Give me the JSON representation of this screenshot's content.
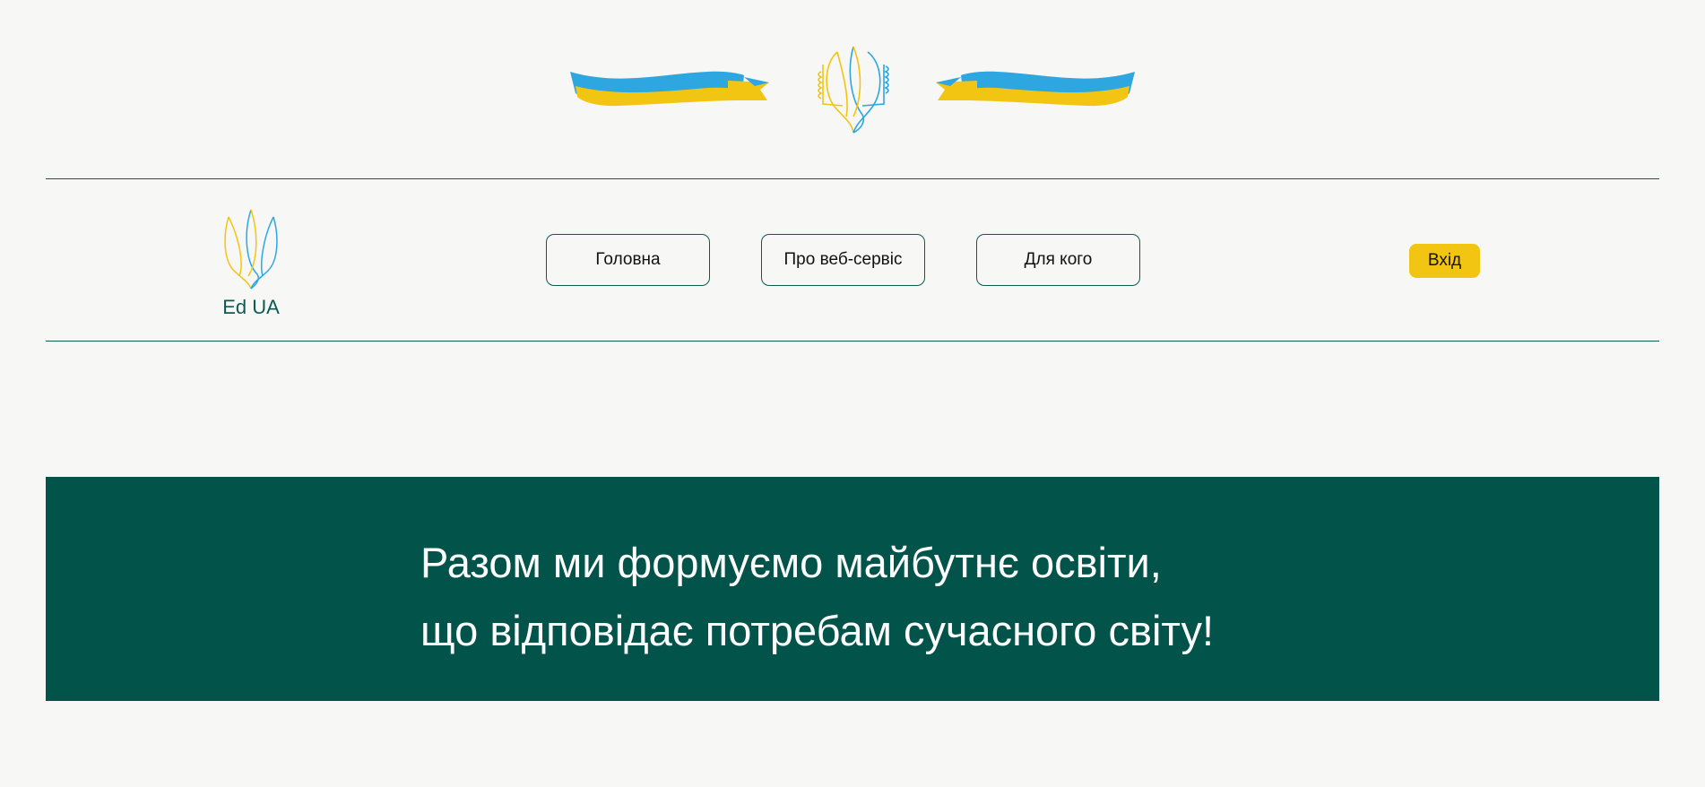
{
  "colors": {
    "background": "#f7f7f6",
    "accent_green": "#02544b",
    "line_green": "#0e5a52",
    "flag_blue": "#2ea7e0",
    "flag_yellow": "#f2c512"
  },
  "header": {
    "emblem_icon": "trident-with-ribbons-icon"
  },
  "logo": {
    "icon": "trident-icon",
    "text": "Ed UA"
  },
  "nav": {
    "items": [
      {
        "label": "Головна"
      },
      {
        "label": "Про веб-сервіс"
      },
      {
        "label": "Для кого"
      }
    ],
    "login_label": "Вхід"
  },
  "banner": {
    "line1": "Разом ми формуємо майбутнє освіти,",
    "line2": "що відповідає потребам сучасного світу!"
  }
}
